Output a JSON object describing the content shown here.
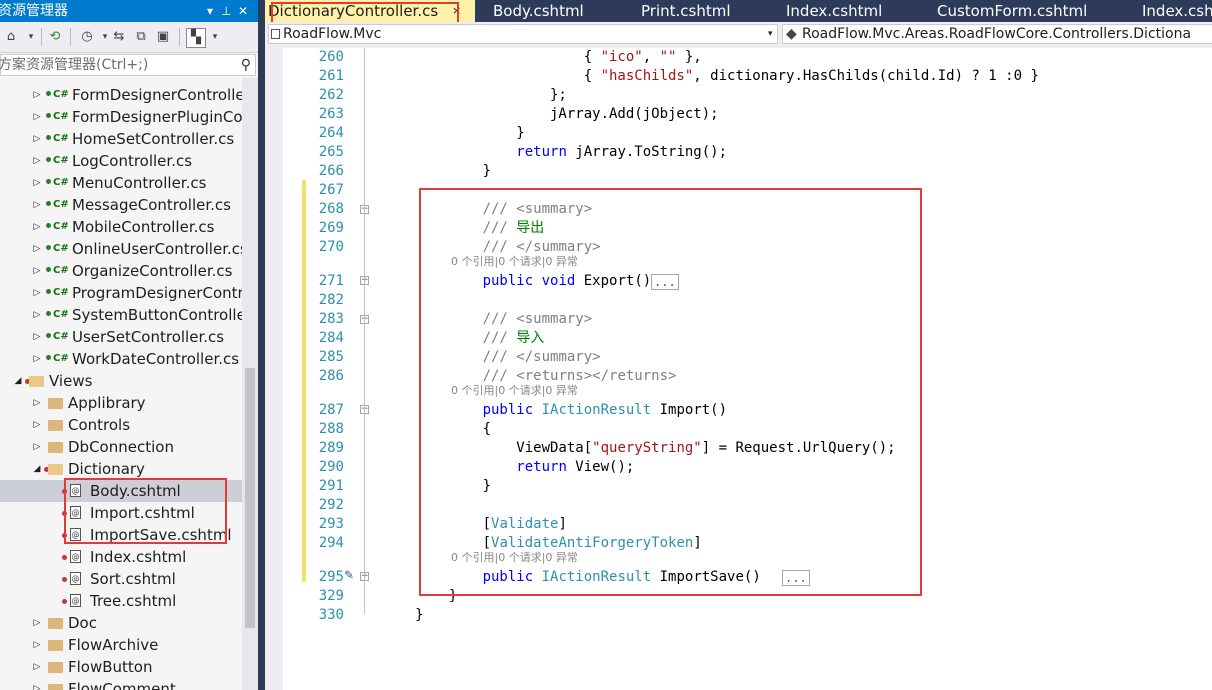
{
  "explorer": {
    "title": "资源管理器",
    "pin_icon": "pin-icon",
    "close_icon": "close-icon",
    "search_placeholder": "方案资源管理器(Ctrl+;)",
    "items": [
      {
        "label": "FormDesignerControlle",
        "kind": "cs"
      },
      {
        "label": "FormDesignerPluginCo",
        "kind": "cs"
      },
      {
        "label": "HomeSetController.cs",
        "kind": "cs"
      },
      {
        "label": "LogController.cs",
        "kind": "cs"
      },
      {
        "label": "MenuController.cs",
        "kind": "cs"
      },
      {
        "label": "MessageController.cs",
        "kind": "cs"
      },
      {
        "label": "MobileController.cs",
        "kind": "cs"
      },
      {
        "label": "OnlineUserController.cs",
        "kind": "cs"
      },
      {
        "label": "OrganizeController.cs",
        "kind": "cs"
      },
      {
        "label": "ProgramDesignerContr",
        "kind": "cs"
      },
      {
        "label": "SystemButtonControlle",
        "kind": "cs"
      },
      {
        "label": "UserSetController.cs",
        "kind": "cs"
      },
      {
        "label": "WorkDateController.cs",
        "kind": "cs"
      },
      {
        "label": "Views",
        "kind": "folder-open"
      },
      {
        "label": "Applibrary",
        "kind": "folder"
      },
      {
        "label": "Controls",
        "kind": "folder"
      },
      {
        "label": "DbConnection",
        "kind": "folder"
      },
      {
        "label": "Dictionary",
        "kind": "folder-open"
      },
      {
        "label": "Body.cshtml",
        "kind": "page"
      },
      {
        "label": "Import.cshtml",
        "kind": "page"
      },
      {
        "label": "ImportSave.cshtml",
        "kind": "page"
      },
      {
        "label": "Index.cshtml",
        "kind": "page"
      },
      {
        "label": "Sort.cshtml",
        "kind": "page"
      },
      {
        "label": "Tree.cshtml",
        "kind": "page"
      },
      {
        "label": "Doc",
        "kind": "folder"
      },
      {
        "label": "FlowArchive",
        "kind": "folder"
      },
      {
        "label": "FlowButton",
        "kind": "folder"
      },
      {
        "label": "FlowComment",
        "kind": "folder"
      }
    ]
  },
  "tabs": [
    {
      "label": "DictionaryController.cs",
      "close": "×"
    },
    {
      "label": "Body.cshtml"
    },
    {
      "label": "Print.cshtml"
    },
    {
      "label": "Index.cshtml"
    },
    {
      "label": "CustomForm.cshtml"
    },
    {
      "label": "Index.csht"
    }
  ],
  "navbar": {
    "project": "RoadFlow.Mvc",
    "namespace": "RoadFlow.Mvc.Areas.RoadFlowCore.Controllers.Dictiona"
  },
  "code": {
    "line_numbers": [
      "260",
      "261",
      "262",
      "263",
      "264",
      "265",
      "266",
      "267",
      "268",
      "269",
      "270",
      "271",
      "282",
      "283",
      "284",
      "285",
      "286",
      "287",
      "288",
      "289",
      "290",
      "291",
      "292",
      "293",
      "294",
      "295",
      "329",
      "330"
    ],
    "codelens": "0 个引用|0 个请求|0 异常",
    "summary_open": "<summary>",
    "summary_close": "</summary>",
    "returns_tag": "<returns></returns>",
    "export_comment": "导出",
    "import_comment": "导入",
    "collapsed": "..."
  }
}
